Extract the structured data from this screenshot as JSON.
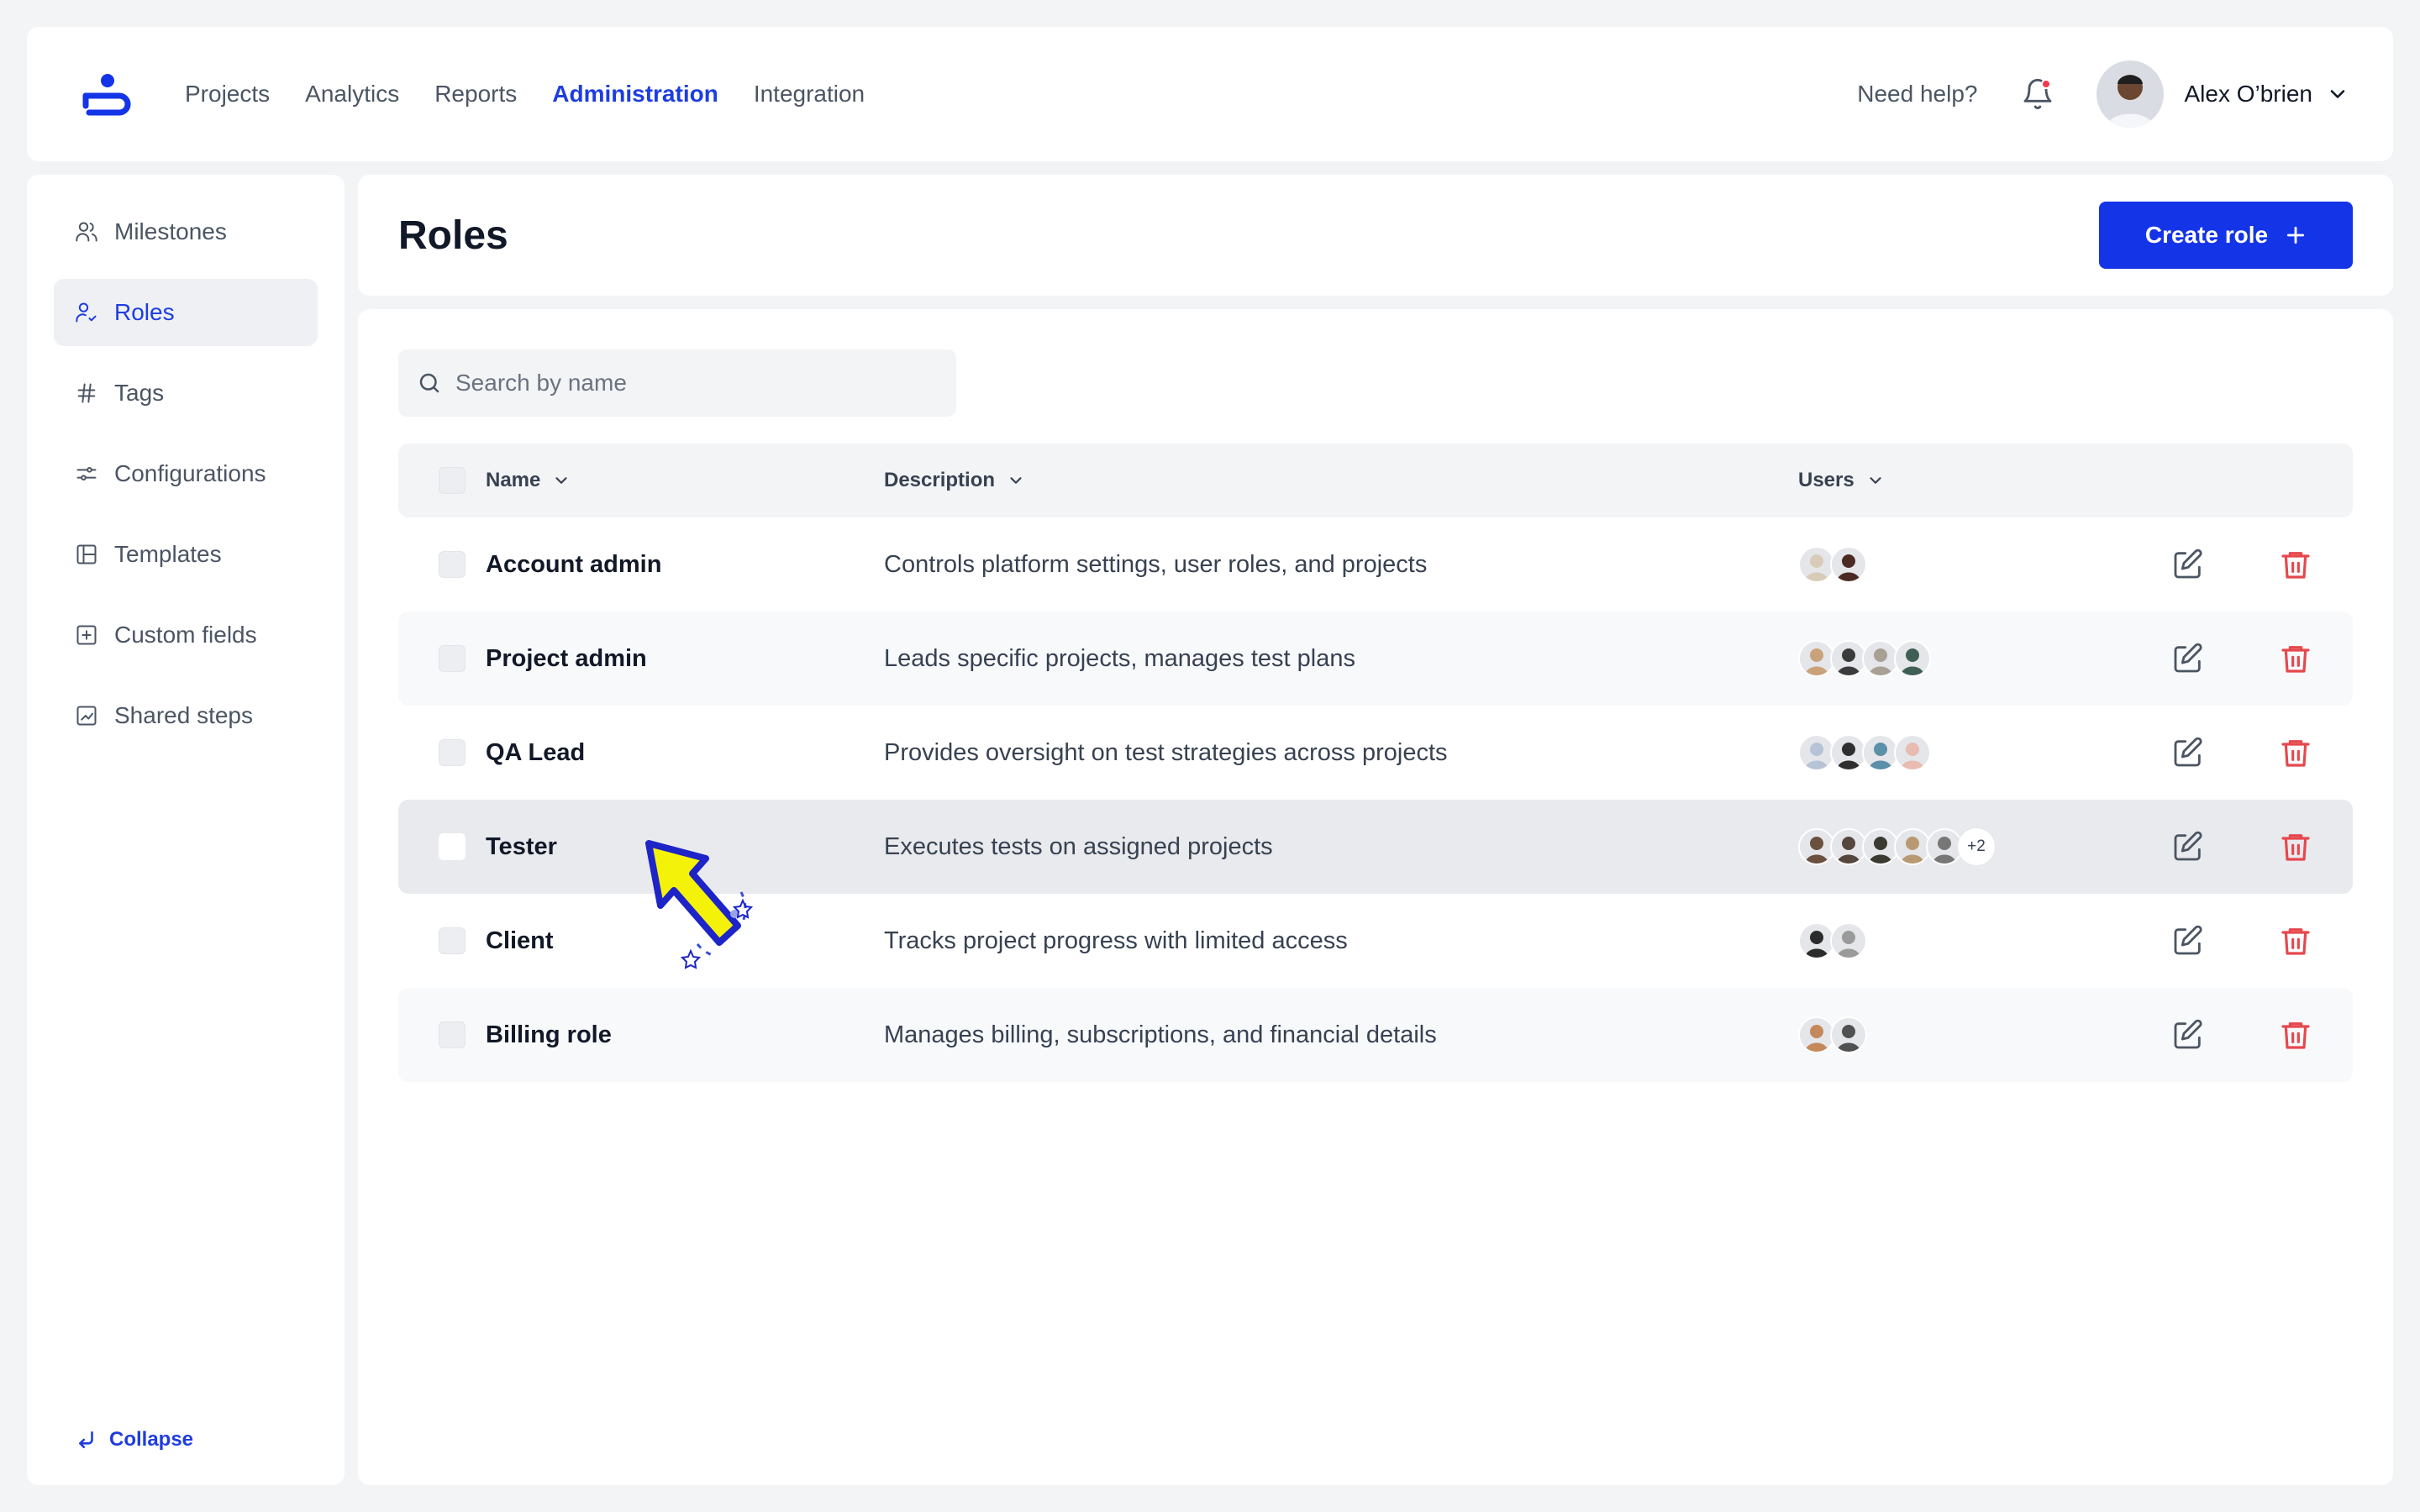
{
  "nav": {
    "items": [
      {
        "label": "Projects",
        "active": false
      },
      {
        "label": "Analytics",
        "active": false
      },
      {
        "label": "Reports",
        "active": false
      },
      {
        "label": "Administration",
        "active": true
      },
      {
        "label": "Integration",
        "active": false
      }
    ],
    "help": "Need help?",
    "user_name": "Alex O’brien",
    "has_notification": true
  },
  "sidebar": {
    "items": [
      {
        "label": "Milestones",
        "icon": "users-icon",
        "active": false
      },
      {
        "label": "Roles",
        "icon": "user-roles-icon",
        "active": true
      },
      {
        "label": "Tags",
        "icon": "hash-icon",
        "active": false
      },
      {
        "label": "Configurations",
        "icon": "sliders-icon",
        "active": false
      },
      {
        "label": "Templates",
        "icon": "layout-icon",
        "active": false
      },
      {
        "label": "Custom fields",
        "icon": "plus-square-icon",
        "active": false
      },
      {
        "label": "Shared steps",
        "icon": "chart-square-icon",
        "active": false
      }
    ],
    "collapse_label": "Collapse"
  },
  "header": {
    "title": "Roles",
    "create_label": "Create role"
  },
  "search": {
    "placeholder": "Search by name",
    "value": ""
  },
  "table": {
    "columns": [
      "Name",
      "Description",
      "Users"
    ],
    "rows": [
      {
        "name": "Account admin",
        "description": "Controls platform settings, user roles, and projects",
        "avatars": [
          "#d8cbb8",
          "#4a2a22"
        ],
        "extra": ""
      },
      {
        "name": "Project admin",
        "description": "Leads specific projects, manages test plans",
        "avatars": [
          "#c9a27a",
          "#3b3b3b",
          "#a89f95",
          "#3f5f55"
        ],
        "extra": ""
      },
      {
        "name": "QA Lead",
        "description": "Provides oversight on test strategies across projects",
        "avatars": [
          "#b7c3d6",
          "#2f2f2f",
          "#5c8fa8",
          "#e8bcb0"
        ],
        "extra": ""
      },
      {
        "name": "Tester",
        "description": "Executes tests on assigned projects",
        "avatars": [
          "#6b5040",
          "#55463e",
          "#3a3a30",
          "#b89a72",
          "#777777"
        ],
        "extra": "+2"
      },
      {
        "name": "Client",
        "description": "Tracks project progress with limited access",
        "avatars": [
          "#2b2b2b",
          "#9a9a9a"
        ],
        "extra": ""
      },
      {
        "name": "Billing role",
        "description": "Manages billing, subscriptions, and financial details",
        "avatars": [
          "#c4885a",
          "#505050"
        ],
        "extra": ""
      }
    ],
    "hovered_row": 3
  },
  "colors": {
    "accent": "#1434e8",
    "danger": "#e5484d",
    "page_bg": "#f3f4f6"
  }
}
